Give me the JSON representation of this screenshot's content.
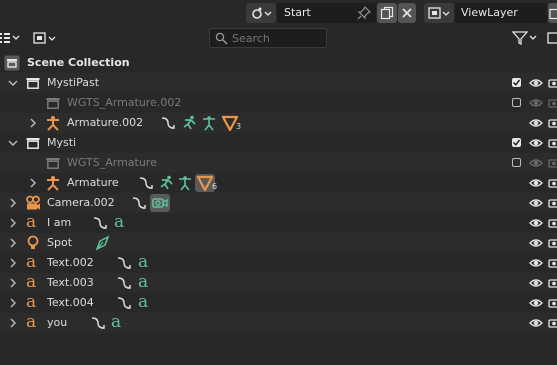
{
  "header": {
    "scene_name": "Start",
    "view_layer": "ViewLayer"
  },
  "search": {
    "placeholder": "Search"
  },
  "outliner": {
    "scene_collection": "Scene Collection",
    "rows": [
      {
        "label": "MystiPast"
      },
      {
        "label": "WGTS_Armature.002"
      },
      {
        "label": "Armature.002",
        "user_count": "3"
      },
      {
        "label": "Mysti"
      },
      {
        "label": "WGTS_Armature"
      },
      {
        "label": "Armature",
        "user_count": "6"
      },
      {
        "label": "Camera.002"
      },
      {
        "label": "I am"
      },
      {
        "label": "Spot"
      },
      {
        "label": "Text.002"
      },
      {
        "label": "Text.003"
      },
      {
        "label": "Text.004"
      },
      {
        "label": "you"
      }
    ]
  },
  "colors": {
    "background": "#282828",
    "row_alt": "#2c2c2c",
    "object_orange": "#e8964a",
    "data_green": "#5fc39a",
    "text": "#dcdcdc",
    "dim_text": "#7a7a7a"
  },
  "icons": [
    "scene-icon",
    "pin-icon",
    "copy-icon",
    "close-icon",
    "view-layer-icon",
    "search-icon",
    "filter-icon",
    "collection-icon",
    "armature-icon",
    "text-icon",
    "camera-icon",
    "light-icon",
    "eye-icon",
    "camera-render-icon",
    "modifier-icon",
    "bone-icon",
    "pose-icon",
    "vertex-group-icon"
  ]
}
